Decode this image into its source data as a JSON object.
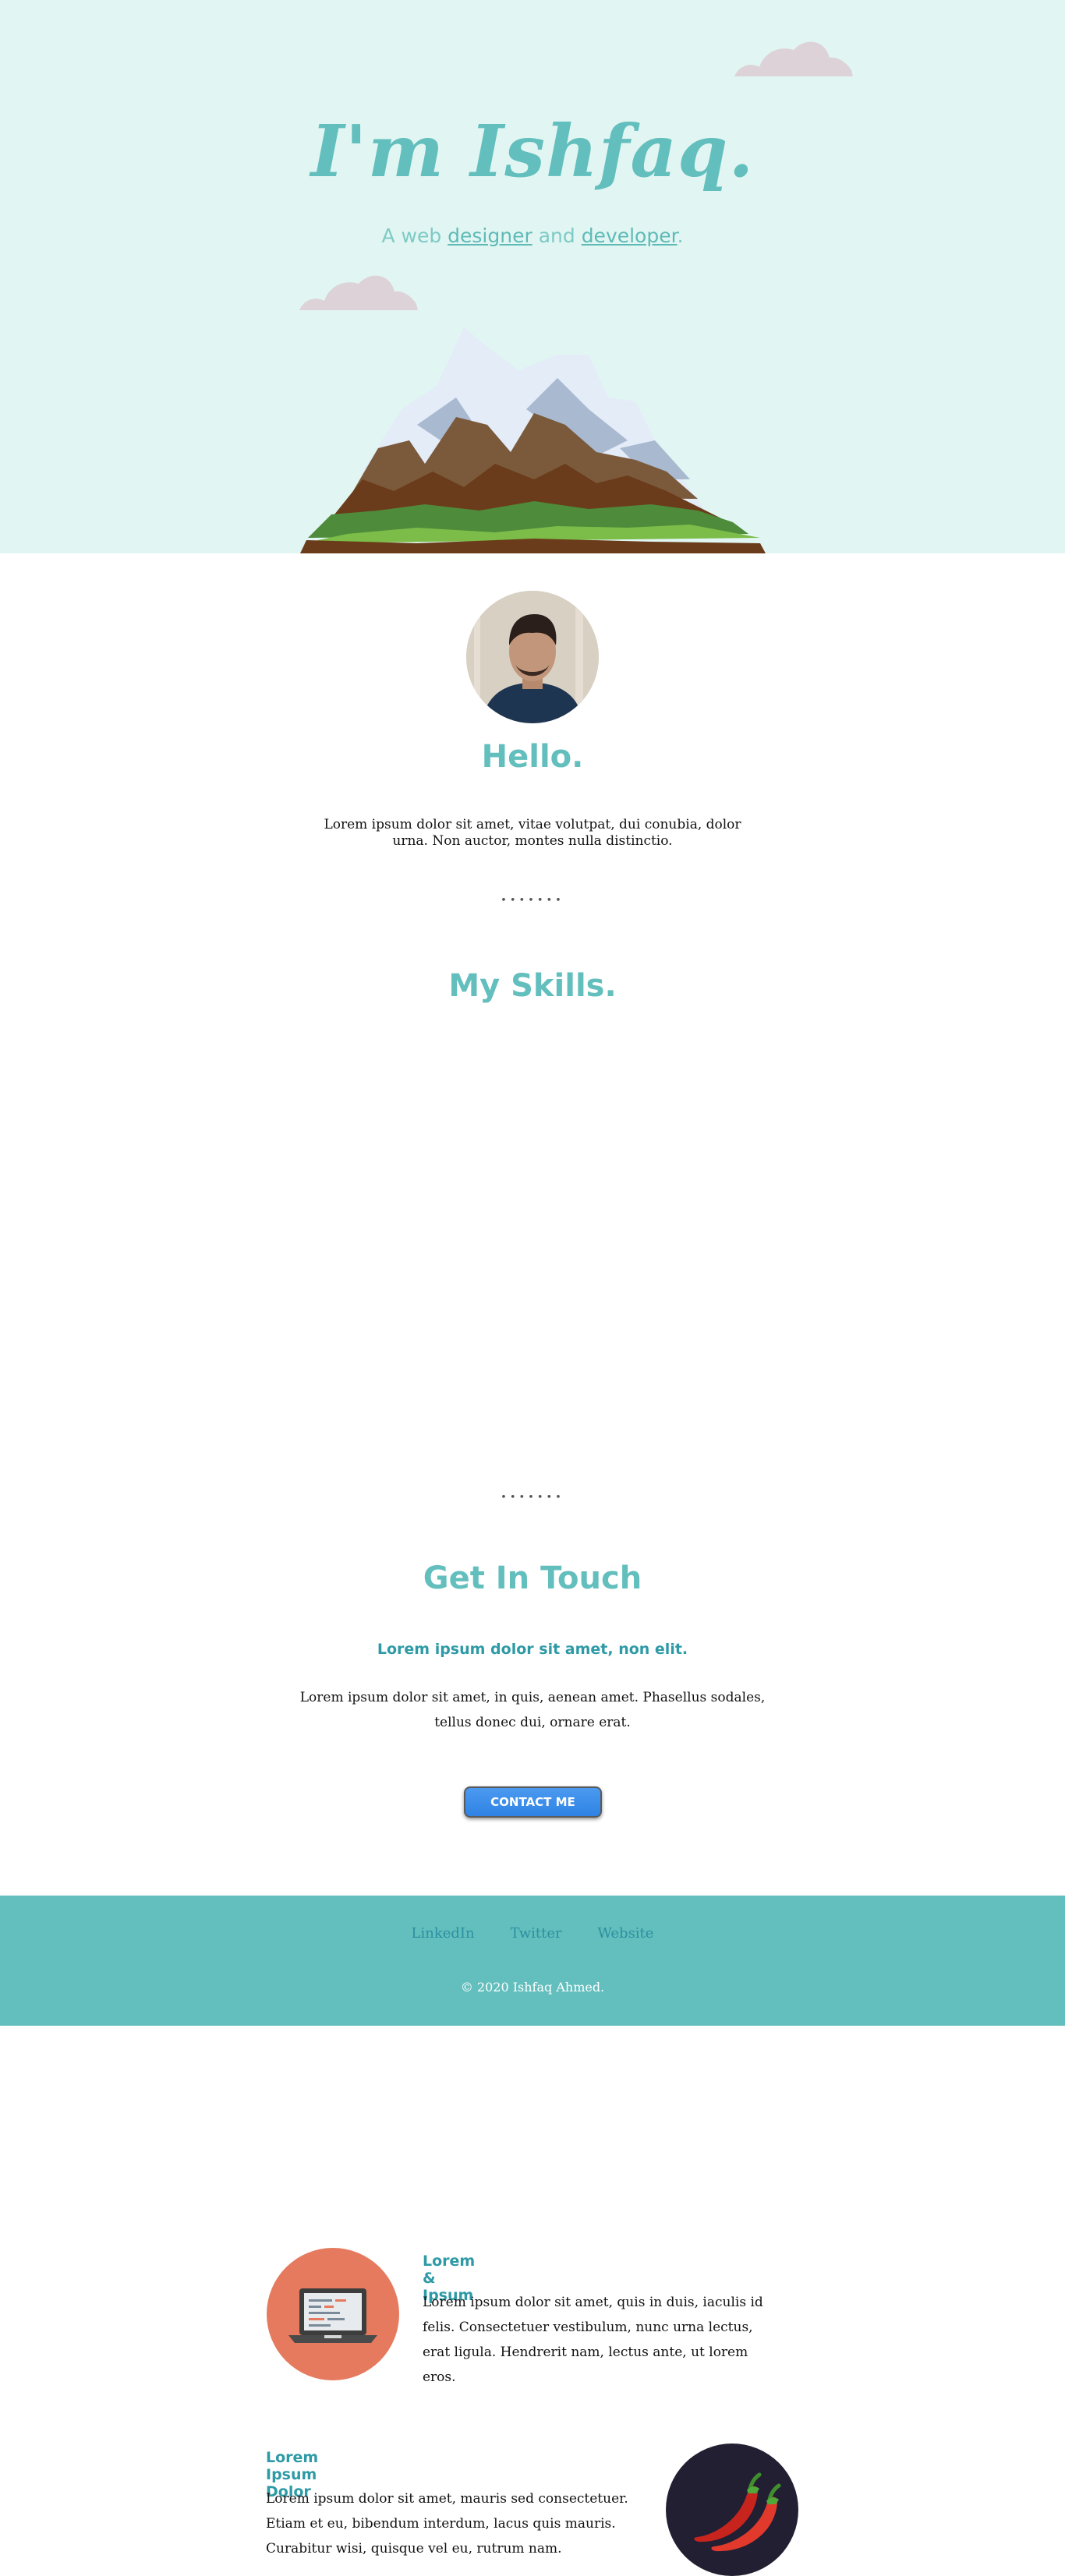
{
  "hero": {
    "title": "I'm Ishfaq.",
    "subtitle_prefix": "A web ",
    "subtitle_link1": "designer",
    "subtitle_mid": " and ",
    "subtitle_link2": "developer",
    "subtitle_suffix": "."
  },
  "about": {
    "heading": "Hello.",
    "text": "Lorem ipsum dolor sit amet, vitae volutpat, dui conubia, dolor urna. Non auctor, montes nulla distinctio.",
    "divider": "•••••••"
  },
  "skills": {
    "heading": "My Skills.",
    "items": [
      {
        "title": "Lorem & Ipsum",
        "text": "Lorem ipsum dolor sit amet, quis in duis, iaculis id felis. Consectetuer vestibulum, nunc urna lectus, erat ligula. Hendrerit nam, lectus ante, ut lorem eros.",
        "icon": "laptop-icon",
        "color": "#e57a5e"
      },
      {
        "title": "Lorem Ipsum Dolor",
        "text": "Lorem ipsum dolor sit amet, mauris sed consectetuer. Etiam et eu, bibendum interdum, lacus quis mauris. Curabitur wisi, quisque vel eu, rutrum nam.",
        "icon": "chili-peppers-icon",
        "color": "#231f32"
      }
    ]
  },
  "contact": {
    "divider": "•••••••",
    "heading": "Get In Touch",
    "subheading": "Lorem ipsum dolor sit amet, non elit.",
    "text": "Lorem ipsum dolor sit amet, in quis, aenean amet. Phasellus sodales, tellus donec dui, ornare erat.",
    "button": "CONTACT ME"
  },
  "footer": {
    "links": [
      "LinkedIn",
      "Twitter",
      "Website"
    ],
    "copyright": "© 2020 Ishfaq Ahmed."
  },
  "colors": {
    "hero_bg": "#e1f6f3",
    "accent": "#63bfbd",
    "link": "#2e9aa6",
    "button": "#3b8fe9",
    "footer_bg": "#63bfbd"
  }
}
